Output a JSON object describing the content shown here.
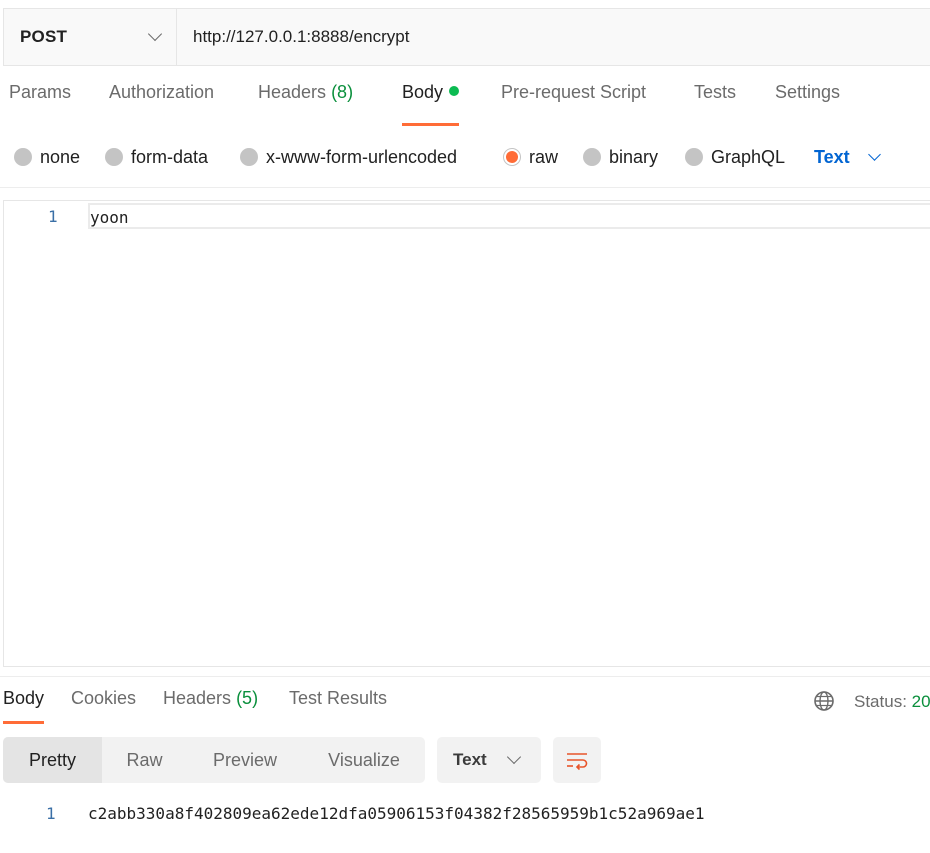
{
  "request": {
    "method": "POST",
    "url": "http://127.0.0.1:8888/encrypt"
  },
  "request_tabs": {
    "params": "Params",
    "authorization": "Authorization",
    "headers": "Headers",
    "headers_count": "(8)",
    "body": "Body",
    "prerequest": "Pre-request Script",
    "tests": "Tests",
    "settings": "Settings"
  },
  "body_types": {
    "none": "none",
    "form_data": "form-data",
    "urlencoded": "x-www-form-urlencoded",
    "raw": "raw",
    "binary": "binary",
    "graphql": "GraphQL",
    "selected": "raw",
    "language": "Text"
  },
  "editor": {
    "line_number": "1",
    "content": "yoon"
  },
  "response_tabs": {
    "body": "Body",
    "cookies": "Cookies",
    "headers": "Headers",
    "headers_count": "(5)",
    "test_results": "Test Results"
  },
  "status": {
    "label": "Status:",
    "code": "20"
  },
  "view_modes": {
    "pretty": "Pretty",
    "raw": "Raw",
    "preview": "Preview",
    "visualize": "Visualize",
    "format": "Text"
  },
  "response": {
    "line_number": "1",
    "content": "c2abb330a8f402809ea62ede12dfa05906153f04382f28565959b1c52a969ae1"
  },
  "colors": {
    "accent": "#ff6c37",
    "link_blue": "#0265d2",
    "success_green": "#0a8f3c"
  }
}
